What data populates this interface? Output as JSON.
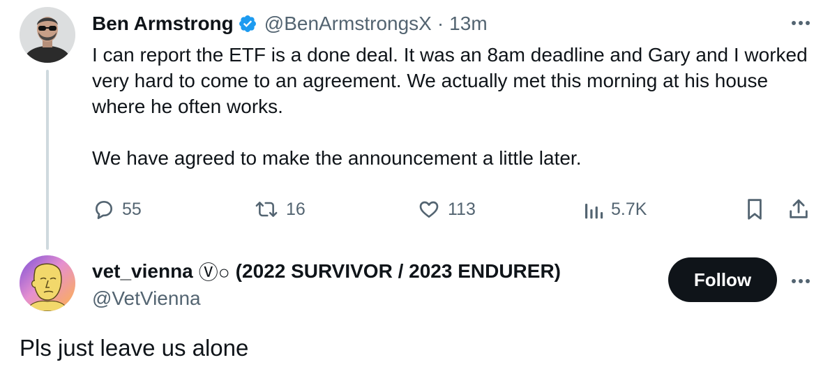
{
  "tweet": {
    "author_name": "Ben Armstrong",
    "handle": "@BenArmstrongsX",
    "separator": "·",
    "time": "13m",
    "text_paragraph_1": "I can report the ETF is a done deal. It was an 8am deadline and Gary and I worked very hard to come to an agreement. We actually met this morning at his house where he often works.",
    "text_paragraph_2": "We have agreed to make the announcement a little later.",
    "actions": {
      "replies": "55",
      "reposts": "16",
      "likes": "113",
      "views": "5.7K"
    },
    "icons": {
      "verified": "verified-badge-icon",
      "more": "more-dots-icon",
      "reply": "reply-bubble-icon",
      "repost": "repost-arrows-icon",
      "like": "heart-icon",
      "views": "bar-chart-icon",
      "bookmark": "bookmark-icon",
      "share": "share-upload-icon"
    }
  },
  "reply": {
    "author_name": "vet_vienna",
    "name_symbols": "Ⓥ○",
    "name_suffix": "(2022 SURVIVOR / 2023 ENDURER)",
    "handle": "@VetVienna",
    "follow_label": "Follow",
    "text": "Pls just leave us alone"
  },
  "colors": {
    "text_primary": "#0f1419",
    "text_secondary": "#536471",
    "verified_blue": "#1d9bf0",
    "thread_line": "#cfd9de",
    "follow_bg": "#0f1419",
    "follow_text": "#ffffff"
  }
}
